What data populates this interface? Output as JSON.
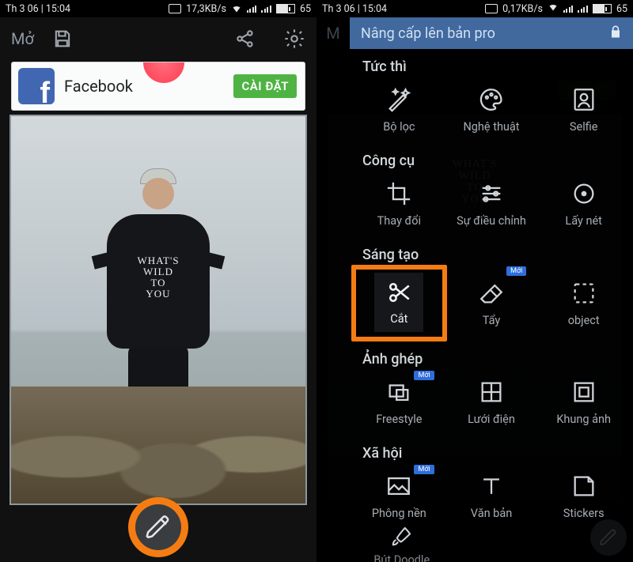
{
  "status": {
    "date_time": "Th 3 06 | 15:04",
    "speed_left": "17,3KB/s",
    "speed_right": "0,17KB/s",
    "battery_pct": "65",
    "battery_fill_pct": 65
  },
  "toolbar": {
    "open_label": "Mở"
  },
  "ad": {
    "title": "Facebook",
    "cta": "CÀI ĐẶT"
  },
  "photo_text": {
    "l1": "WHAT'S",
    "l2": "WILD",
    "l3": "TO",
    "l4": "YOU"
  },
  "pro_banner": {
    "label": "Nâng cấp lên bản pro"
  },
  "sections": {
    "instant": "Tức thì",
    "tools": "Công cụ",
    "creative": "Sáng tạo",
    "collage": "Ảnh ghép",
    "social": "Xã hội"
  },
  "badges": {
    "new": "Mới"
  },
  "items": {
    "filter": "Bộ lọc",
    "art": "Nghệ thuật",
    "selfie": "Selfie",
    "resize": "Thay đổi",
    "adjust": "Sự điều chỉnh",
    "focus": "Lấy nét",
    "cut": "Cắt",
    "eraser": "Tẩy",
    "object": "object",
    "freestyle": "Freestyle",
    "grid": "Lưới điện",
    "frame": "Khung ảnh",
    "background": "Phông nền",
    "text": "Văn bản",
    "stickers": "Stickers",
    "doodle": "Bút Doodle"
  },
  "colors": {
    "accent": "#f57c13",
    "blue": "#41699e"
  }
}
